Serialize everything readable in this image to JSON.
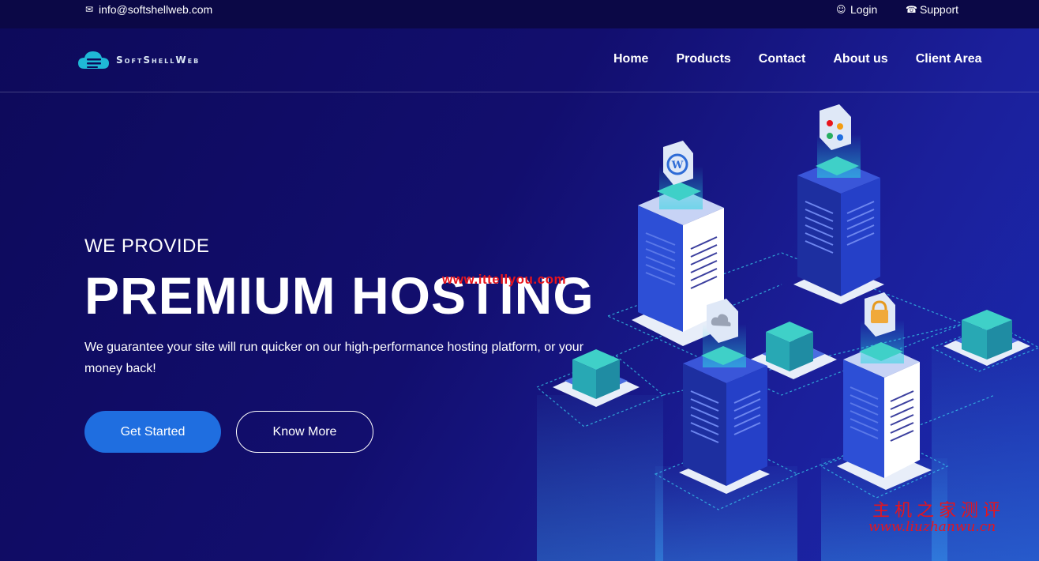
{
  "topbar": {
    "email": "info@softshellweb.com",
    "login": "Login",
    "support": "Support"
  },
  "brand": {
    "name": "SoftShellWeb"
  },
  "nav": {
    "items": [
      {
        "label": "Home"
      },
      {
        "label": "Products"
      },
      {
        "label": "Contact"
      },
      {
        "label": "About us"
      },
      {
        "label": "Client Area"
      }
    ]
  },
  "hero": {
    "subtitle": "WE PROVIDE",
    "title": "PREMIUM HOSTING",
    "description": "We guarantee your site will run quicker on our high-performance hosting platform, or your money back!",
    "primary_button": "Get Started",
    "secondary_button": "Know More"
  },
  "watermarks": {
    "center": "www.ittellyou.com",
    "cn_text": "主机之家测评",
    "cn_url": "www.liuzhanwu.cn"
  },
  "colors": {
    "background": "#120e6e",
    "topbar": "#0b0846",
    "primary_button": "#1f6ee0",
    "watermark": "#e8141c"
  },
  "icons": {
    "email": "envelope-icon",
    "login": "user-icon",
    "support": "headset-icon",
    "app_wordpress": "wordpress-icon",
    "app_joomla": "joomla-icon",
    "app_cloud": "cloud-icon",
    "app_lock": "lock-icon"
  }
}
